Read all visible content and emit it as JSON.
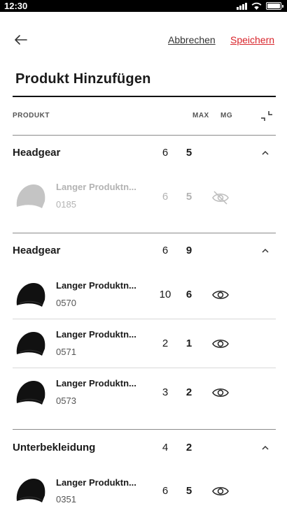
{
  "status_bar": {
    "time": "12:30"
  },
  "header": {
    "cancel_label": "Abbrechen",
    "save_label": "Speichern",
    "save_color": "#d8232a"
  },
  "page": {
    "title": "Produkt Hinzufügen"
  },
  "columns": {
    "product": "PRODUKT",
    "max": "MAX",
    "mg": "MG"
  },
  "groups": [
    {
      "name": "Headgear",
      "max": "6",
      "mg": "5",
      "products": [
        {
          "name": "Langer Produktn...",
          "code": "0185",
          "max": "6",
          "mg": "5",
          "visible": false,
          "image": "beanie-grey"
        }
      ]
    },
    {
      "name": "Headgear",
      "max": "6",
      "mg": "9",
      "products": [
        {
          "name": "Langer Produktn...",
          "code": "0570",
          "max": "10",
          "mg": "6",
          "visible": true,
          "image": "beanie-black"
        },
        {
          "name": "Langer Produktn...",
          "code": "0571",
          "max": "2",
          "mg": "1",
          "visible": true,
          "image": "beanie-black"
        },
        {
          "name": "Langer Produktn...",
          "code": "0573",
          "max": "3",
          "mg": "2",
          "visible": true,
          "image": "beanie-black"
        }
      ]
    },
    {
      "name": "Unterbekleidung",
      "max": "4",
      "mg": "2",
      "products": [
        {
          "name": "Langer Produktn...",
          "code": "0351",
          "max": "6",
          "mg": "5",
          "visible": true,
          "image": "beanie-black"
        }
      ]
    }
  ]
}
